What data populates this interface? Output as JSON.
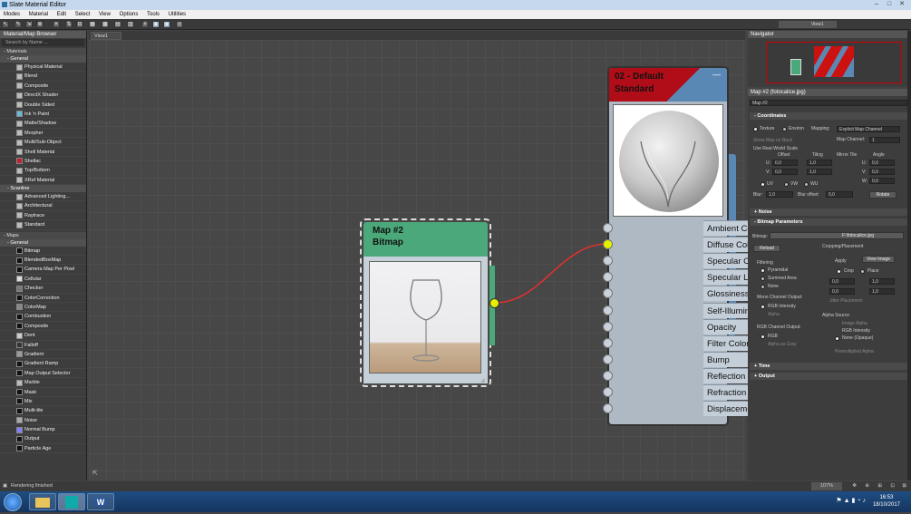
{
  "window": {
    "title": "Slate Material Editor"
  },
  "menu": [
    "Modes",
    "Material",
    "Edit",
    "Select",
    "View",
    "Options",
    "Tools",
    "Utilities"
  ],
  "toolbar": {
    "view_dropdown": "View1"
  },
  "browser": {
    "title": "Material/Map Browser",
    "search_placeholder": "Search by Name ...",
    "materials_section": "- Materials",
    "general_group": "- General",
    "general_items": [
      "Physical Material",
      "Blend",
      "Composite",
      "DirectX Shader",
      "Double Sided",
      "Ink 'n Paint",
      "Matte/Shadow",
      "Morpher",
      "Multi/Sub-Object",
      "Shell Material",
      "Shellac",
      "Top/Bottom",
      "XRef Material"
    ],
    "scanline_group": "- Scanline",
    "scanline_items": [
      "Advanced Lighting...",
      "Architectural",
      "Raytrace",
      "Standard"
    ],
    "maps_section": "- Maps",
    "maps_group": "- General",
    "map_items": [
      "Bitmap",
      "BlendedBoxMap",
      "Camera Map Per Pixel",
      "Cellular",
      "Checker",
      "ColorCorrection",
      "ColorMap",
      "Combustion",
      "Composite",
      "Dent",
      "Falloff",
      "Gradient",
      "Gradient Ramp",
      "Map Output Selector",
      "Marble",
      "Mask",
      "Mix",
      "Multi-tile",
      "Noise",
      "Normal Bump",
      "Output",
      "Particle Age"
    ]
  },
  "canvas": {
    "tab": "View1"
  },
  "bitmap_node": {
    "title_line1": "Map #2",
    "title_line2": "Bitmap"
  },
  "material_node": {
    "title_line1": "02 - Default",
    "title_line2": "Standard",
    "minimize": "—",
    "slots": [
      "Ambient Color",
      "Diffuse Color",
      "Specular Color",
      "Specular Level",
      "Glossiness",
      "Self-Illumination",
      "Opacity",
      "Filter Color",
      "Bump",
      "Reflection",
      "Refraction",
      "Displacement"
    ]
  },
  "navigator": {
    "title": "Navigator"
  },
  "params": {
    "title": "Map #2 (fotocalice.jpg)",
    "name": "Map #2",
    "coordinates": "Coordinates",
    "texture": "Texture",
    "environ": "Environ",
    "mapping_label": "Mapping:",
    "mapping_value": "Explicit Map Channel",
    "map_channel_label": "Map Channel:",
    "map_channel_value": "1",
    "show_map_on_back": "Show Map on Back",
    "use_real_world": "Use Real-World Scale",
    "offset": "Offset",
    "tiling": "Tiling",
    "mirror_tile": "Mirror Tile",
    "angle": "Angle",
    "u": "U:",
    "v": "V:",
    "w": "W:",
    "u_offset": "0,0",
    "v_offset": "0,0",
    "u_tiling": "1,0",
    "v_tiling": "1,0",
    "u_angle": "0,0",
    "v_angle": "0,0",
    "w_angle": "0,0",
    "uv": "UV",
    "vw": "VW",
    "wu": "WU",
    "blur": "Blur:",
    "blur_value": "1,0",
    "blur_offset": "Blur offset:",
    "blur_offset_value": "0,0",
    "rotate": "Rotate",
    "noise": "Noise",
    "bitmap_params": "Bitmap Parameters",
    "bitmap_label": "Bitmap:",
    "bitmap_path": "F:\\fotocalice.jpg",
    "reload": "Reload",
    "cropping": "Cropping/Placement",
    "apply": "Apply",
    "view_image": "View Image",
    "crop": "Crop",
    "place": "Place",
    "filtering": "Filtering",
    "pyramidal": "Pyramidal",
    "summed_area": "Summed Area",
    "none": "None",
    "mono_output": "Mono Channel Output:",
    "rgb_intensity": "RGB Intensity",
    "alpha": "Alpha",
    "rgb_output": "RGB Channel Output:",
    "rgb": "RGB",
    "alpha_as_gray": "Alpha as Gray",
    "alpha_source": "Alpha Source",
    "image_alpha": "Image Alpha",
    "none_opaque": "None (Opaque)",
    "premult": "Premultiplied Alpha",
    "jitter": "Jitter Placement:",
    "jitter_value": "1,0",
    "crop_u": "0,0",
    "crop_v": "0,0",
    "crop_w": "1,0",
    "crop_h": "1,0",
    "time": "Time",
    "output": "Output"
  },
  "status": {
    "text": "Rendering finished",
    "zoom": "107%"
  },
  "taskbar": {
    "time": "16:53",
    "date": "18/10/2017",
    "word": "W"
  }
}
